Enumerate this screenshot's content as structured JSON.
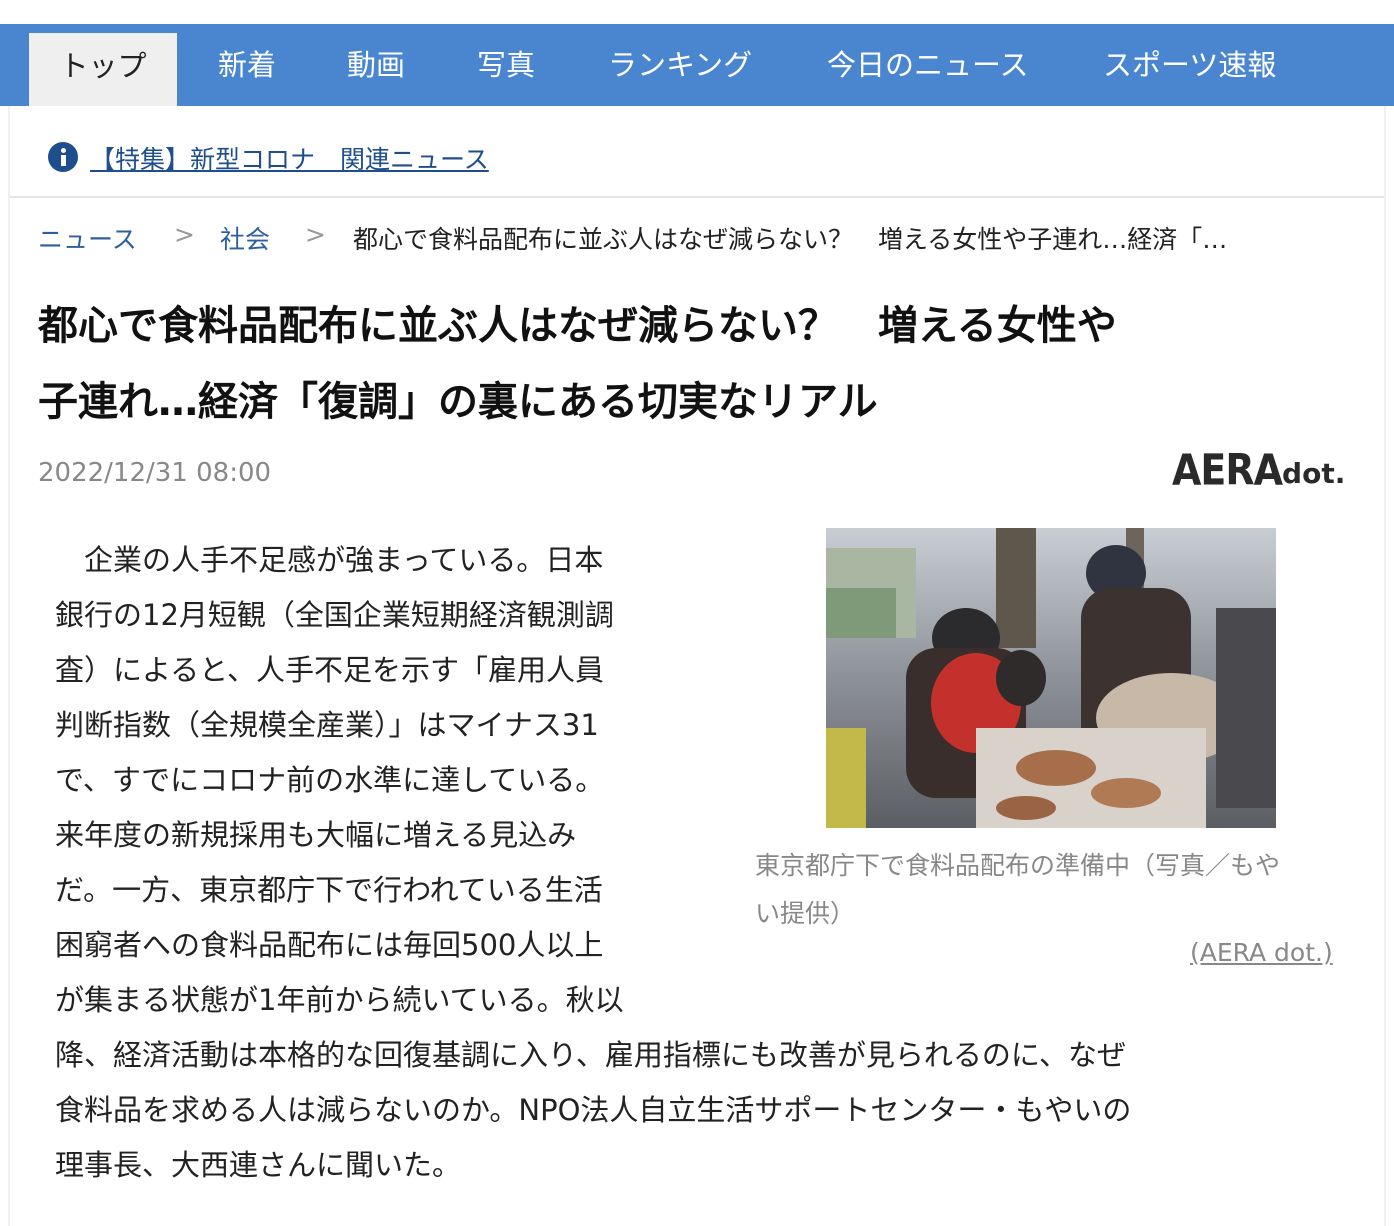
{
  "nav": {
    "tabs": [
      {
        "label": "トップ"
      },
      {
        "label": "新着"
      },
      {
        "label": "動画"
      },
      {
        "label": "写真"
      },
      {
        "label": "ランキング"
      },
      {
        "label": "今日のニュース"
      },
      {
        "label": "スポーツ速報"
      }
    ],
    "active_color": "#efefef",
    "bar_color": "#4a86cf"
  },
  "banner": {
    "icon": "info-icon",
    "link_text": "【特集】新型コロナ　関連ニュース"
  },
  "breadcrumb": {
    "items": [
      "ニュース",
      "社会"
    ],
    "separator": ">",
    "current": "都心で食料品配布に並ぶ人はなぜ減らない？　増える女性や子連れ…経済「…"
  },
  "article": {
    "headline_lines": [
      "都心で食料品配布に並ぶ人はなぜ減らない？　増える女性や",
      "子連れ…経済「復調」の裏にある切実なリアル"
    ],
    "date": "2022/12/31 08:00",
    "publisher_logo": {
      "main": "AERA",
      "sub": "dot."
    },
    "body_lines": [
      "　企業の人手不足感が強まっている。日本",
      "銀行の12月短観（全国企業短期経済観測調",
      "査）によると、人手不足を示す「雇用人員",
      "判断指数（全規模全産業）」はマイナス31",
      "で、すでにコロナ前の水準に達している。",
      "来年度の新規採用も大幅に増える見込み",
      "だ。一方、東京都庁下で行われている生活",
      "困窮者への食料品配布には毎回500人以上",
      "が集まる状態が1年前から続いている。秋以",
      "降、経済活動は本格的な回復基調に入り、雇用指標にも改善が見られるのに、なぜ",
      "食料品を求める人は減らないのか。NPO法人自立生活サポートセンター・もやいの",
      "理事長、大西連さんに聞いた。"
    ],
    "photo": {
      "caption_lines": [
        "東京都庁下で食料品配布の準備中（写真／もや",
        "い提供）"
      ],
      "source": "(AERA dot.)"
    }
  }
}
